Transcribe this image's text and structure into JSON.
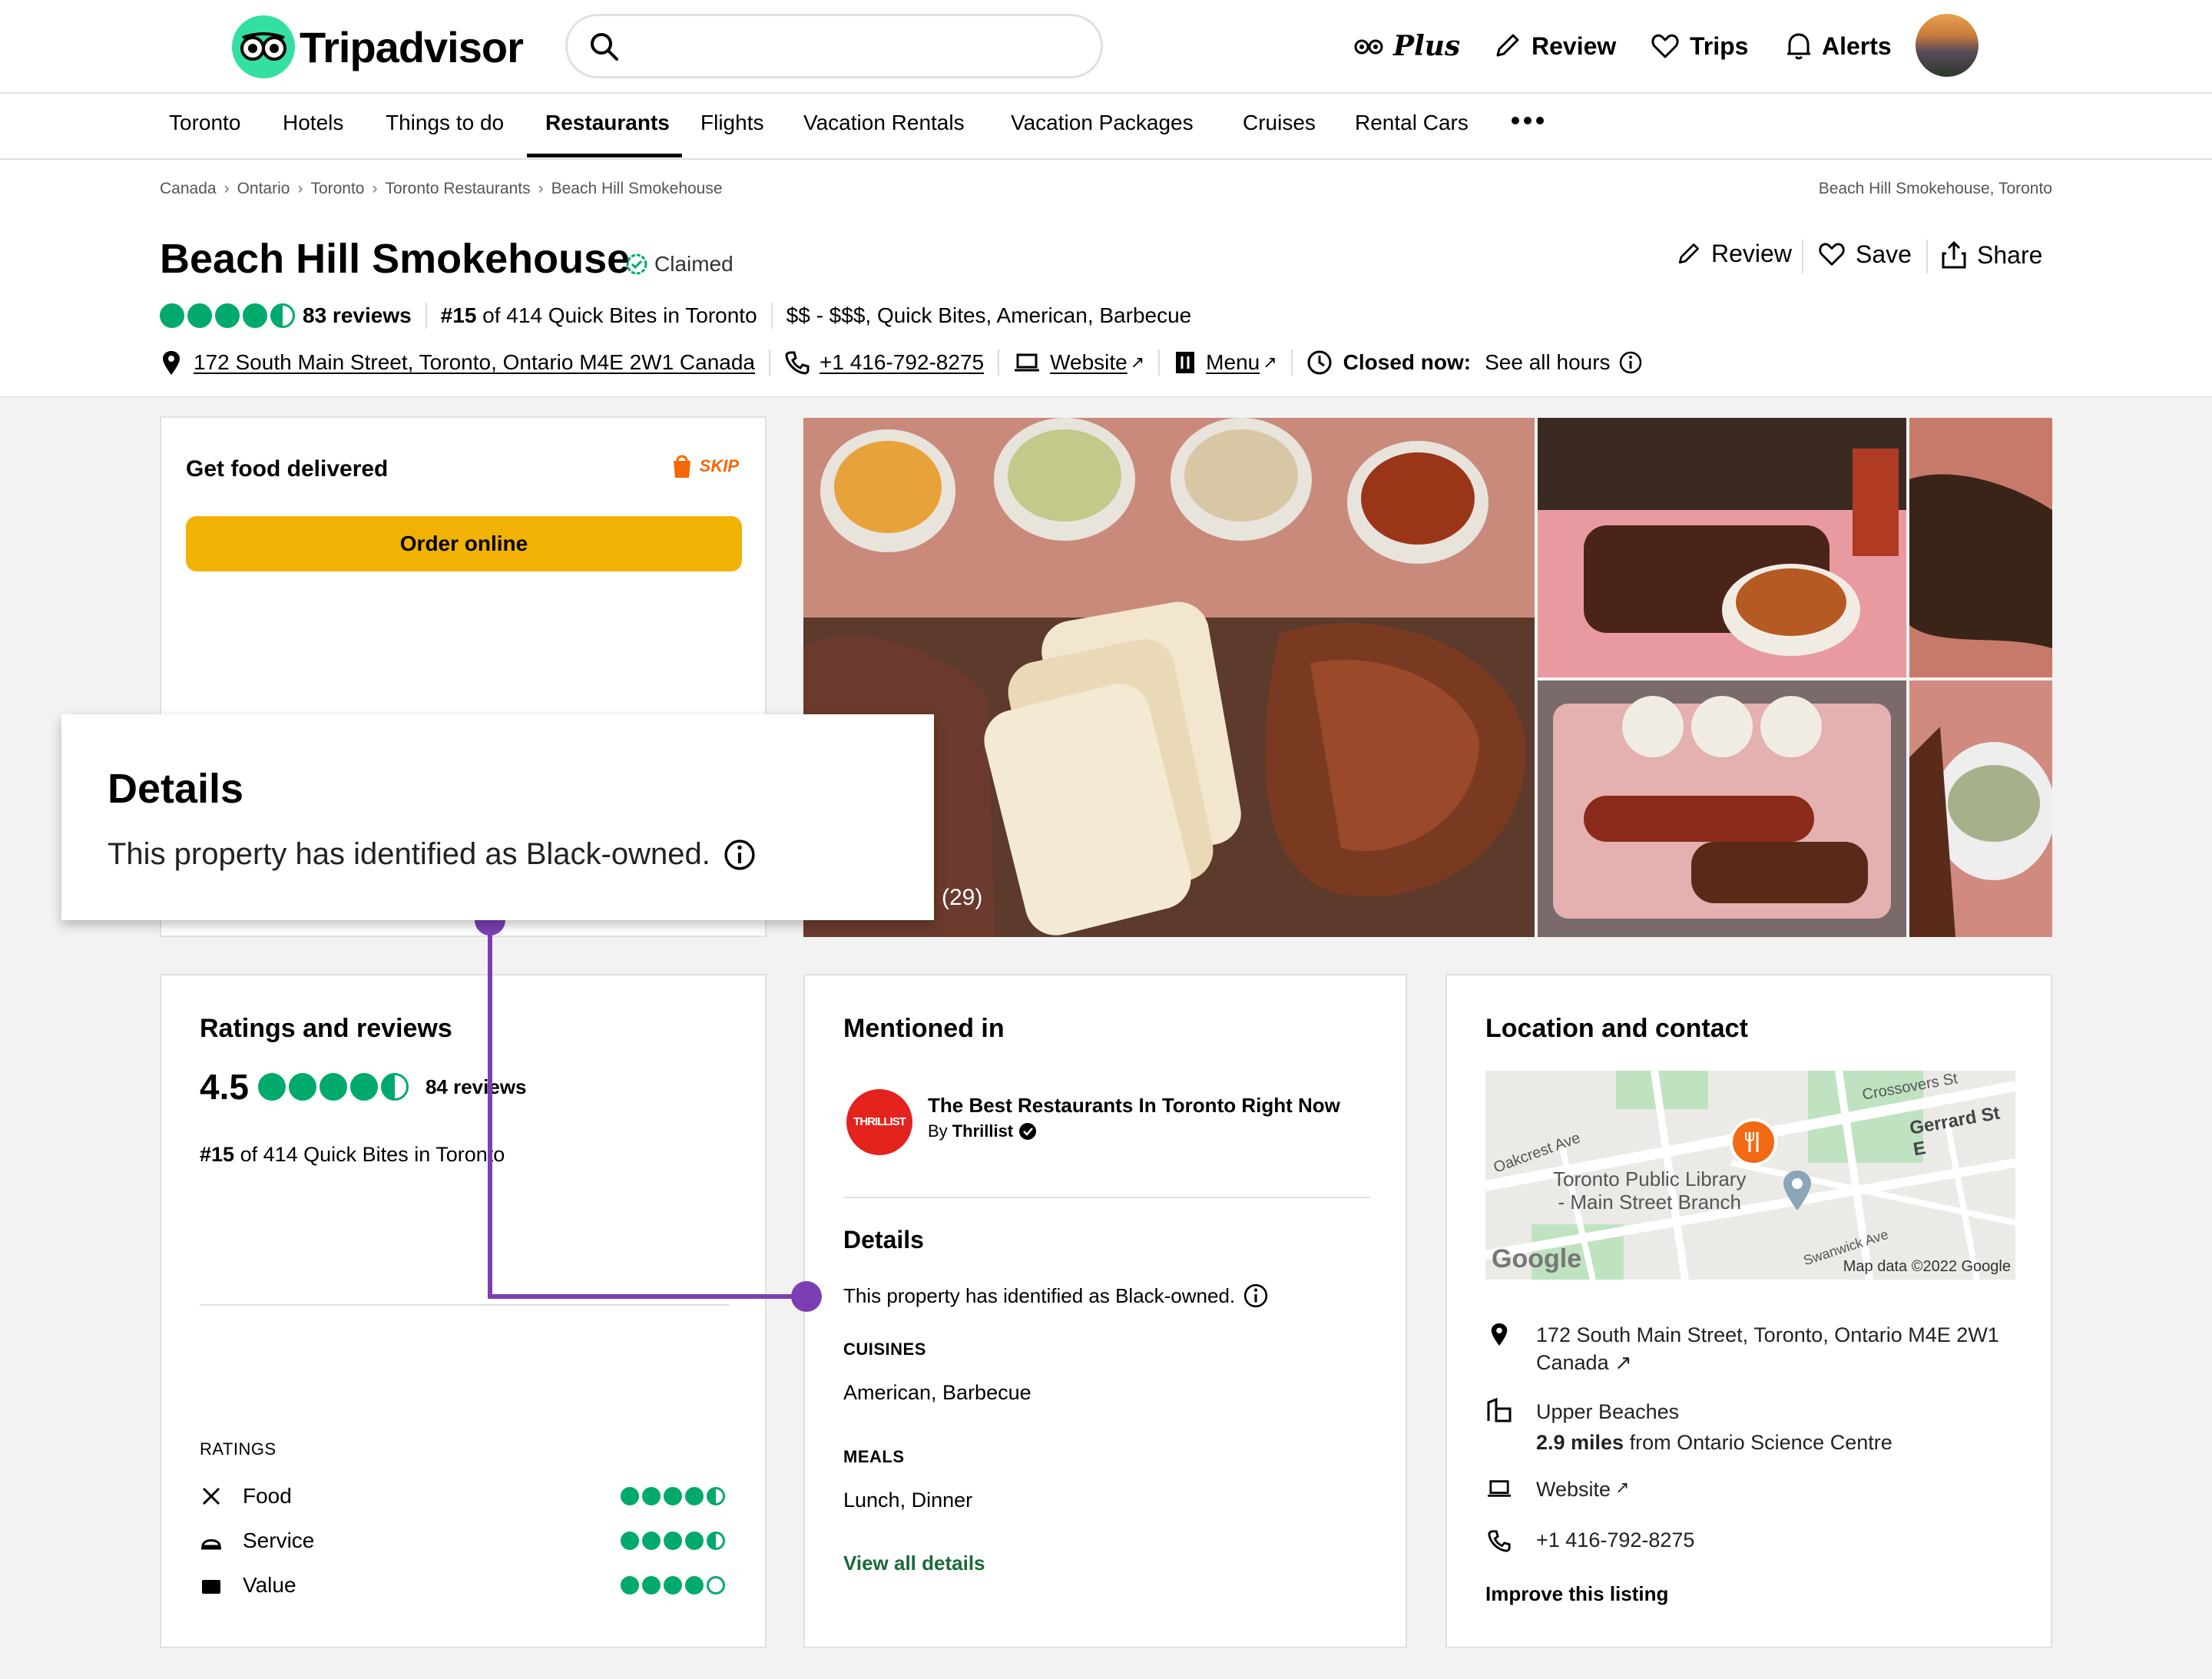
{
  "header": {
    "logo_text": "Tripadvisor",
    "search_placeholder": "",
    "nav": {
      "plus": "Plus",
      "review": "Review",
      "trips": "Trips",
      "alerts": "Alerts"
    }
  },
  "subnav": {
    "items": [
      "Toronto",
      "Hotels",
      "Things to do",
      "Restaurants",
      "Flights",
      "Vacation Rentals",
      "Vacation Packages",
      "Cruises",
      "Rental Cars"
    ],
    "active": "Restaurants"
  },
  "breadcrumb": {
    "items": [
      "Canada",
      "Ontario",
      "Toronto",
      "Toronto Restaurants",
      "Beach Hill Smokehouse"
    ],
    "right": "Beach Hill Smokehouse, Toronto"
  },
  "restaurant": {
    "name": "Beach Hill Smokehouse",
    "claimed": "Claimed",
    "rating": 4.5,
    "reviews": "83 reviews",
    "rank_bold": "#15",
    "rank_rest": "of 414 Quick Bites in Toronto",
    "price_cuisine": "$$ - $$$, Quick Bites, American, Barbecue",
    "address": "172 South Main Street, Toronto, Ontario M4E 2W1 Canada",
    "phone": "+1 416-792-8275",
    "website": "Website",
    "menu": "Menu",
    "closed_label": "Closed now:",
    "hours_link": "See all hours"
  },
  "actions": {
    "review": "Review",
    "save": "Save",
    "share": "Share"
  },
  "delivery": {
    "title": "Get food delivered",
    "partner": "SKIP",
    "button": "Order online"
  },
  "gallery": {
    "count": "(29)"
  },
  "popup": {
    "title": "Details",
    "text": "This property has identified as Black-owned."
  },
  "ratings_card": {
    "title": "Ratings and reviews",
    "score": "4.5",
    "reviews": "84 reviews",
    "rank_bold": "#15",
    "rank_rest": "of 414 Quick Bites in Toronto",
    "section": "RATINGS",
    "items": [
      {
        "label": "Food",
        "value": 4.5
      },
      {
        "label": "Service",
        "value": 4.5
      },
      {
        "label": "Value",
        "value": 4.0
      }
    ]
  },
  "mentioned_card": {
    "title": "Mentioned in",
    "badge": "THRILLIST",
    "article_title": "The Best Restaurants In Toronto Right Now",
    "article_by": "By",
    "article_source": "Thrillist",
    "details_title": "Details",
    "details_text": "This property has identified as Black-owned.",
    "cuisines_label": "CUISINES",
    "cuisines": "American, Barbecue",
    "meals_label": "MEALS",
    "meals": "Lunch, Dinner",
    "view_all": "View all details"
  },
  "location_card": {
    "title": "Location and contact",
    "map": {
      "street1": "Crossovers St",
      "street2": "Gerrard St E",
      "street3": "Oakcrest Ave",
      "street4": "Swanwick Ave",
      "poi_line1": "Toronto Public Library",
      "poi_line2": "- Main Street Branch",
      "brand": "Google",
      "attribution": "Map data ©2022 Google"
    },
    "address_line1": "172 South Main Street, Toronto, Ontario M4E 2W1",
    "address_line2": "Canada",
    "neighborhood": "Upper Beaches",
    "distance_bold": "2.9 miles",
    "distance_rest": "from Ontario Science Centre",
    "website": "Website",
    "phone": "+1 416-792-8275",
    "improve": "Improve this listing"
  },
  "colors": {
    "green": "#00aa6c",
    "purple": "#7b3fb3",
    "order": "#f2b203"
  }
}
